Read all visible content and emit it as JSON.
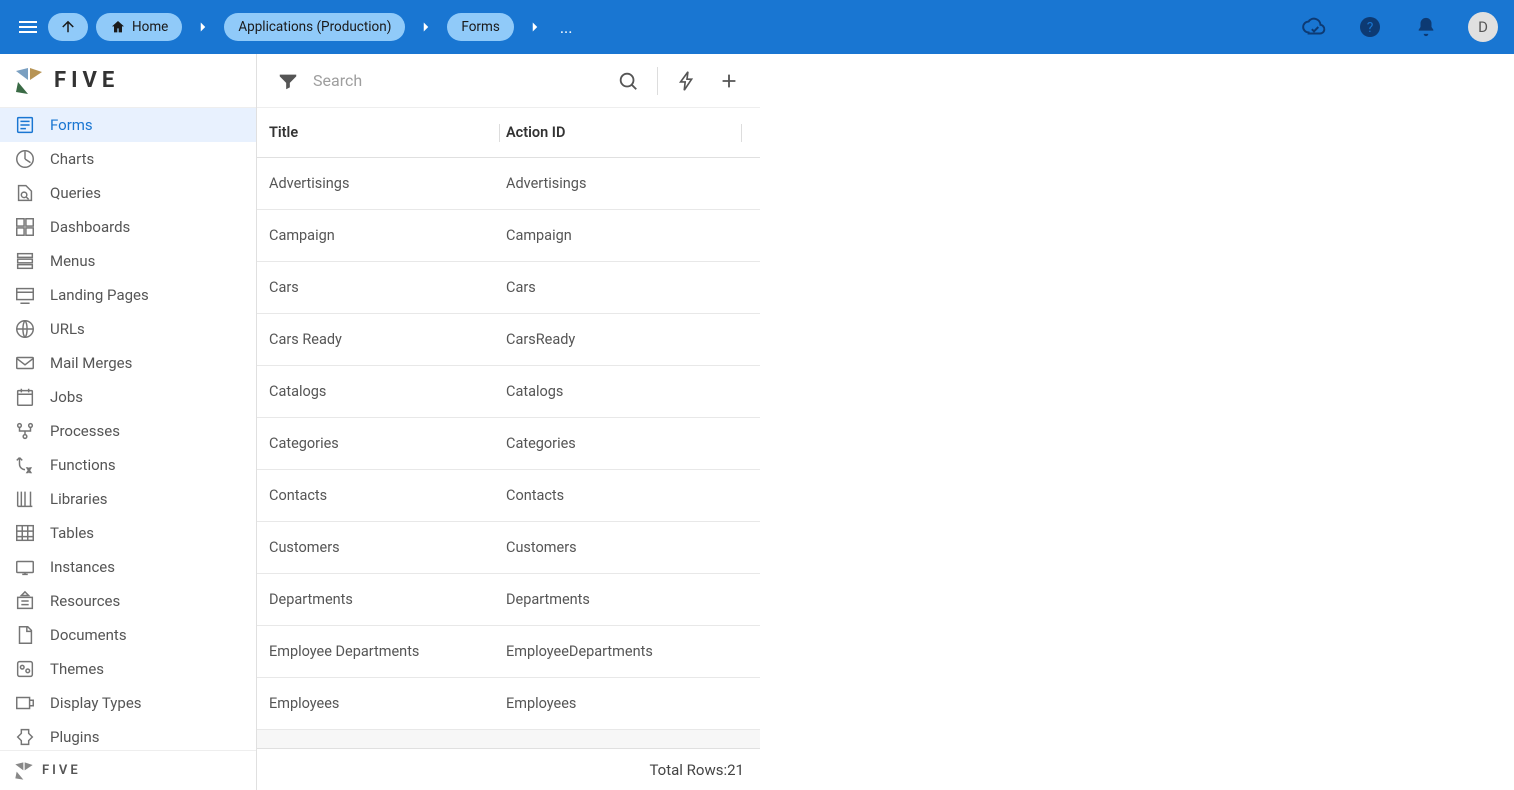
{
  "header": {
    "breadcrumbs": {
      "home": "Home",
      "applications": "Applications (Production)",
      "forms": "Forms",
      "ellipsis": "..."
    },
    "avatar_letter": "D"
  },
  "logo": "FIVE",
  "sidebar": {
    "items": [
      {
        "label": "Forms",
        "active": true
      },
      {
        "label": "Charts"
      },
      {
        "label": "Queries"
      },
      {
        "label": "Dashboards"
      },
      {
        "label": "Menus"
      },
      {
        "label": "Landing Pages"
      },
      {
        "label": "URLs"
      },
      {
        "label": "Mail Merges"
      },
      {
        "label": "Jobs"
      },
      {
        "label": "Processes"
      },
      {
        "label": "Functions"
      },
      {
        "label": "Libraries"
      },
      {
        "label": "Tables"
      },
      {
        "label": "Instances"
      },
      {
        "label": "Resources"
      },
      {
        "label": "Documents"
      },
      {
        "label": "Themes"
      },
      {
        "label": "Display Types"
      },
      {
        "label": "Plugins"
      }
    ]
  },
  "footer_logo": "FIVE",
  "search": {
    "placeholder": "Search"
  },
  "columns": {
    "title": "Title",
    "action_id": "Action ID"
  },
  "rows": [
    {
      "title": "Advertisings",
      "action_id": "Advertisings"
    },
    {
      "title": "Campaign",
      "action_id": "Campaign"
    },
    {
      "title": "Cars",
      "action_id": "Cars"
    },
    {
      "title": "Cars Ready",
      "action_id": "CarsReady"
    },
    {
      "title": "Catalogs",
      "action_id": "Catalogs"
    },
    {
      "title": "Categories",
      "action_id": "Categories"
    },
    {
      "title": "Contacts",
      "action_id": "Contacts"
    },
    {
      "title": "Customers",
      "action_id": "Customers"
    },
    {
      "title": "Departments",
      "action_id": "Departments"
    },
    {
      "title": "Employee Departments",
      "action_id": "EmployeeDepartments"
    },
    {
      "title": "Employees",
      "action_id": "Employees"
    }
  ],
  "list_footer": {
    "prefix": "Total Rows: ",
    "count": "21"
  }
}
